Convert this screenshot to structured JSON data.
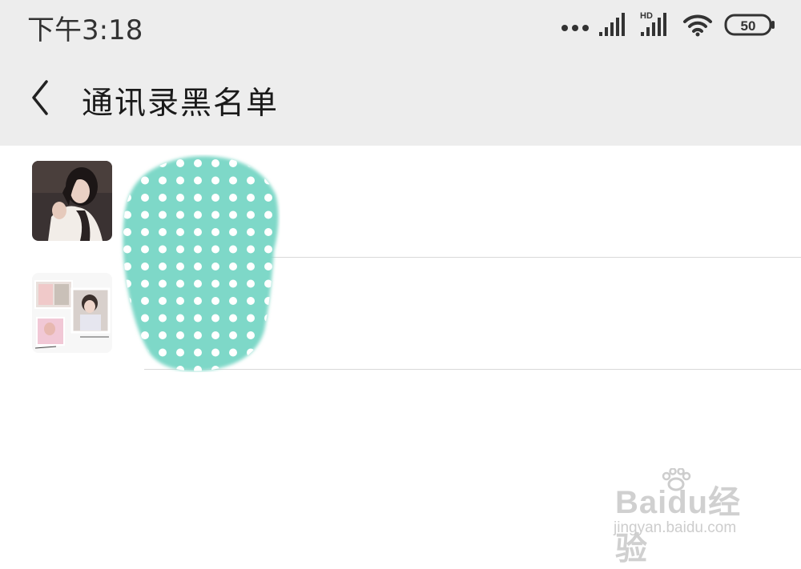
{
  "status_bar": {
    "time": "下午3:18",
    "hd_label": "HD",
    "battery": "50"
  },
  "header": {
    "title": "通讯录黑名单"
  },
  "list": {
    "items": [
      {
        "avatar": "avatar-photo-girl",
        "name": ""
      },
      {
        "avatar": "avatar-photo-collage",
        "name": ""
      }
    ]
  },
  "watermark": {
    "brand": "Baidu经验",
    "url": "jingyan.baidu.com"
  },
  "colors": {
    "header_bg": "#ededed",
    "redaction": "#7ed8c8",
    "divider": "#d9d9d9"
  }
}
